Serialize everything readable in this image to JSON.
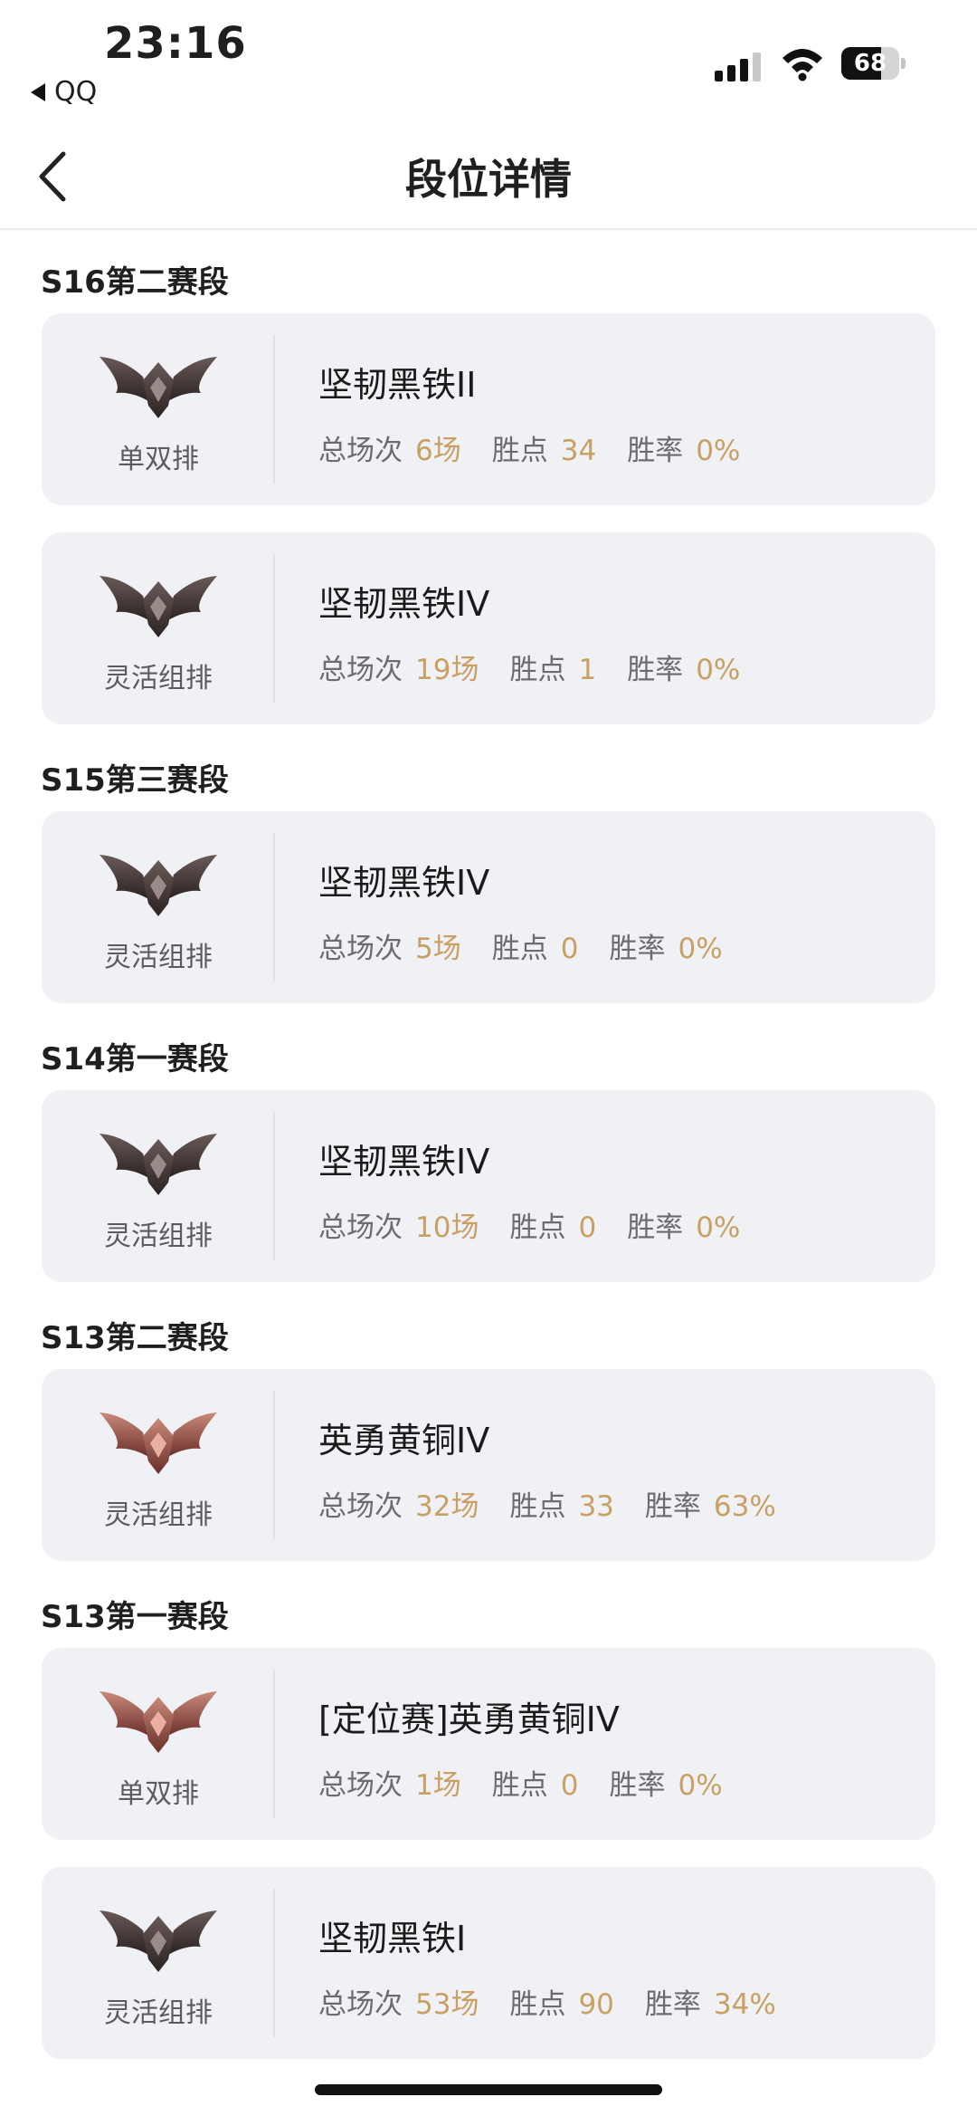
{
  "status_bar": {
    "time": "23:16",
    "back_app": "QQ",
    "battery": 68
  },
  "nav": {
    "title": "段位详情"
  },
  "labels": {
    "games": "总场次",
    "points": "胜点",
    "winrate": "胜率"
  },
  "colors": {
    "accent": "#c9a063",
    "card_bg": "#f0f1f5"
  },
  "sections": [
    {
      "title": "S16第二赛段",
      "cards": [
        {
          "mode": "单双排",
          "rank": "坚韧黑铁II",
          "games": "6场",
          "points": "34",
          "winrate": "0%",
          "emblem": "iron-emblem-icon"
        },
        {
          "mode": "灵活组排",
          "rank": "坚韧黑铁IV",
          "games": "19场",
          "points": "1",
          "winrate": "0%",
          "emblem": "iron-emblem-icon"
        }
      ]
    },
    {
      "title": "S15第三赛段",
      "cards": [
        {
          "mode": "灵活组排",
          "rank": "坚韧黑铁IV",
          "games": "5场",
          "points": "0",
          "winrate": "0%",
          "emblem": "iron-emblem-icon"
        }
      ]
    },
    {
      "title": "S14第一赛段",
      "cards": [
        {
          "mode": "灵活组排",
          "rank": "坚韧黑铁IV",
          "games": "10场",
          "points": "0",
          "winrate": "0%",
          "emblem": "iron-emblem-icon"
        }
      ]
    },
    {
      "title": "S13第二赛段",
      "cards": [
        {
          "mode": "灵活组排",
          "rank": "英勇黄铜IV",
          "games": "32场",
          "points": "33",
          "winrate": "63%",
          "emblem": "bronze-emblem-icon"
        }
      ]
    },
    {
      "title": "S13第一赛段",
      "cards": [
        {
          "mode": "单双排",
          "rank": "[定位赛]英勇黄铜IV",
          "games": "1场",
          "points": "0",
          "winrate": "0%",
          "emblem": "bronze-emblem-icon"
        },
        {
          "mode": "灵活组排",
          "rank": "坚韧黑铁I",
          "games": "53场",
          "points": "90",
          "winrate": "34%",
          "emblem": "iron-emblem-icon"
        }
      ]
    }
  ]
}
